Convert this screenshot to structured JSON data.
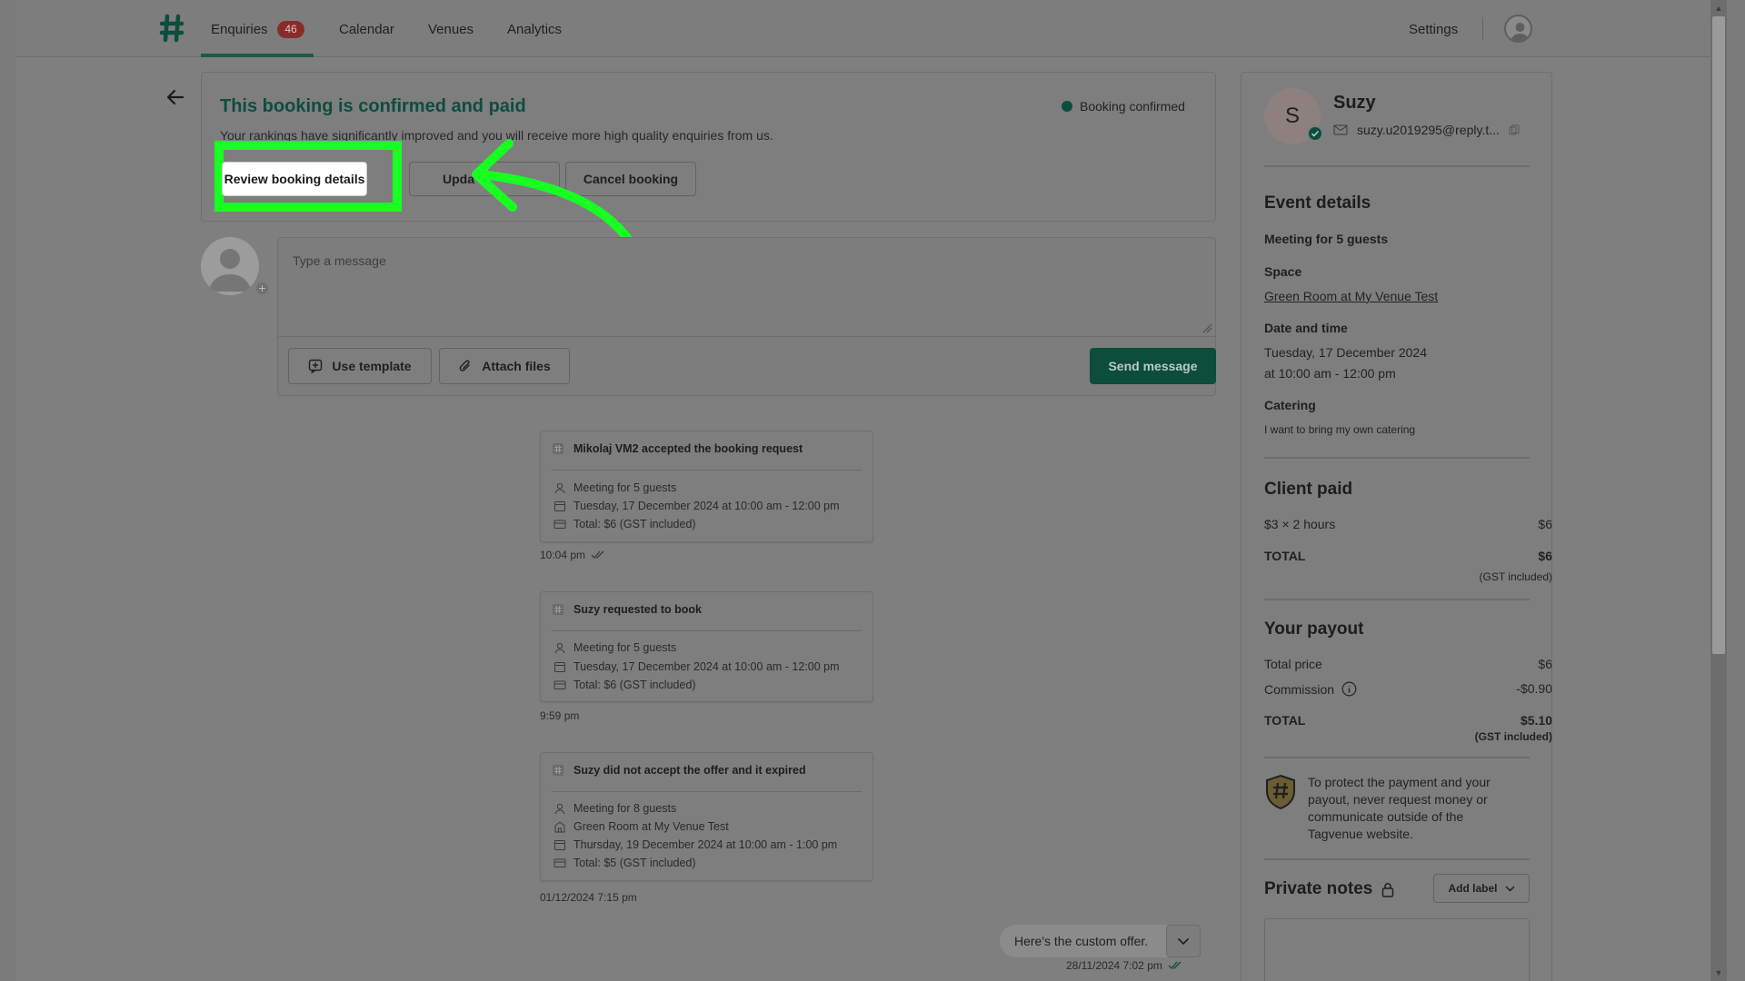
{
  "nav": {
    "items": [
      "Enquiries",
      "Calendar",
      "Venues",
      "Analytics"
    ],
    "enquiries_badge": "46",
    "settings": "Settings"
  },
  "status": {
    "title": "This booking is confirmed and paid",
    "subtitle": "Your rankings have significantly improved and you will receive more high quality enquiries from us.",
    "pill": "Booking confirmed",
    "review_button": "Review booking details",
    "update_button": "Upda",
    "cancel_button": "Cancel booking"
  },
  "composer": {
    "placeholder": "Type a message",
    "use_template": "Use template",
    "attach_files": "Attach files",
    "send": "Send message"
  },
  "timeline": [
    {
      "title": "Mikolaj VM2 accepted the booking request",
      "rows": [
        "Meeting for 5 guests",
        "Tuesday, 17 December 2024 at 10:00 am - 12:00 pm",
        "Total: $6 (GST included)"
      ],
      "time": "10:04 pm"
    },
    {
      "title": "Suzy requested to book",
      "rows": [
        "Meeting for 5 guests",
        "Tuesday, 17 December 2024 at 10:00 am - 12:00 pm",
        "Total: $6 (GST included)"
      ],
      "time": "9:59 pm"
    },
    {
      "title": "Suzy did not accept the offer and it expired",
      "rows": [
        "Meeting for 8 guests",
        "Green Room at My Venue Test",
        "Thursday, 19 December 2024 at 10:00 am - 1:00 pm",
        "Total: $5 (GST included)"
      ],
      "time": "01/12/2024 7:15 pm"
    }
  ],
  "offer": {
    "text": "Here's the custom offer.",
    "time": "28/11/2024 7:02 pm"
  },
  "sidebar": {
    "avatar_letter": "S",
    "name": "Suzy",
    "email": "suzy.u2019295@reply.t...",
    "event_heading": "Event details",
    "event_title": "Meeting for 5 guests",
    "space_label": "Space",
    "space_value": "Green Room at My Venue Test",
    "datetime_label": "Date and time",
    "date_value": "Tuesday, 17 December 2024",
    "time_value": "at 10:00 am - 12:00 pm",
    "catering_label": "Catering",
    "catering_value": "I want to bring my own catering",
    "client_paid_heading": "Client paid",
    "line_item": "$3 × 2 hours",
    "line_item_amount": "$6",
    "total_label": "TOTAL",
    "total_amount": "$6",
    "gst_note": "(GST included)",
    "payout_heading": "Your payout",
    "total_price_label": "Total price",
    "total_price_amount": "$6",
    "commission_label": "Commission",
    "commission_amount": "-$0.90",
    "payout_total_label": "TOTAL",
    "payout_total_amount": "$5.10",
    "payout_gst_note": "(GST included)",
    "protect_text": "To protect the payment and your payout, never request money or communicate outside of the Tagvenue website.",
    "notes_heading": "Private notes",
    "add_label": "Add label"
  },
  "colors": {
    "brand_green": "#0c4d3b",
    "highlight": "#18ff22",
    "badge_red": "#8a2b2b"
  }
}
